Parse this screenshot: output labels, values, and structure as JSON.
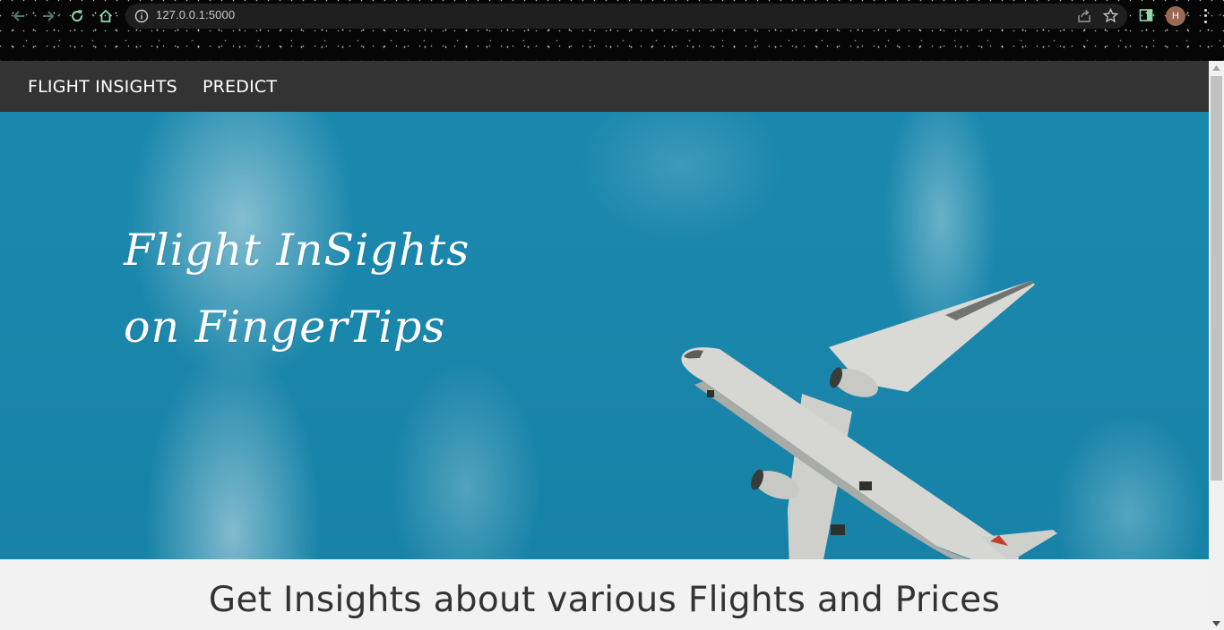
{
  "browser": {
    "url": "127.0.0.1:5000",
    "profile_initial": "H",
    "icons": {
      "back": "arrow-left-icon",
      "forward": "arrow-right-icon",
      "reload": "reload-icon",
      "home": "home-icon",
      "site_info": "info-icon",
      "share": "share-icon",
      "bookmark": "star-icon",
      "side_panel": "side-panel-icon",
      "menu": "kebab-menu-icon"
    },
    "accent_color": "#8fd9a8"
  },
  "site_nav": {
    "items": [
      {
        "label": "FLIGHT INSIGHTS"
      },
      {
        "label": "PREDICT"
      }
    ],
    "background": "#333333"
  },
  "hero": {
    "title_line1": "Flight InSights",
    "title_line2": "on FingerTips",
    "image": "airplane-in-sky",
    "sky_color": "#1a88ad"
  },
  "content": {
    "heading": "Get Insights about various Flights and Prices"
  }
}
